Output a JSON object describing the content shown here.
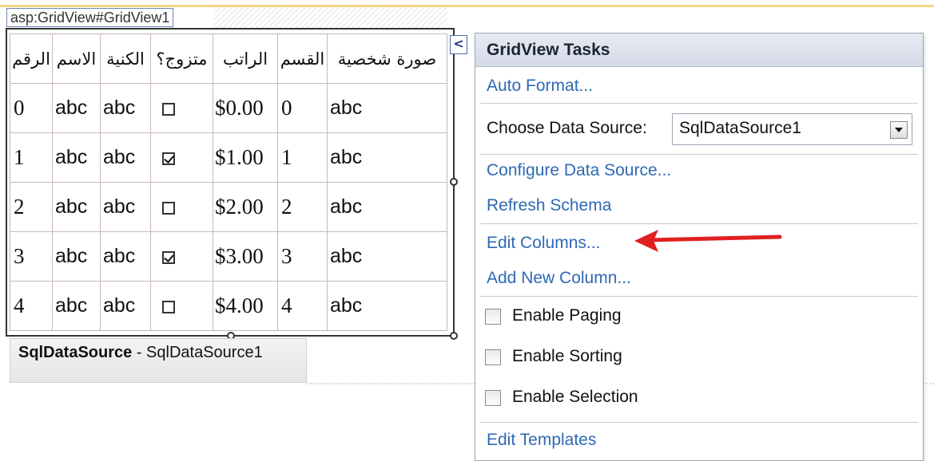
{
  "designer_tag": "asp:GridView#GridView1",
  "grid": {
    "headers": [
      "صورة شخصية",
      "القسم",
      "الراتب",
      "متزوج؟",
      "الكنية",
      "الاسم",
      "الرقم"
    ],
    "rows": [
      {
        "id": "0",
        "first": "abc",
        "last": "abc",
        "married": false,
        "salary": "$0.00",
        "dept": "0",
        "photo": "abc"
      },
      {
        "id": "1",
        "first": "abc",
        "last": "abc",
        "married": true,
        "salary": "$1.00",
        "dept": "1",
        "photo": "abc"
      },
      {
        "id": "2",
        "first": "abc",
        "last": "abc",
        "married": false,
        "salary": "$2.00",
        "dept": "2",
        "photo": "abc"
      },
      {
        "id": "3",
        "first": "abc",
        "last": "abc",
        "married": true,
        "salary": "$3.00",
        "dept": "3",
        "photo": "abc"
      },
      {
        "id": "4",
        "first": "abc",
        "last": "abc",
        "married": false,
        "salary": "$4.00",
        "dept": "4",
        "photo": "abc"
      }
    ]
  },
  "sql_data_source": {
    "type": "SqlDataSource",
    "separator": " - ",
    "name": "SqlDataSource1"
  },
  "collapse_button": "<",
  "tasks_panel": {
    "title": "GridView Tasks",
    "auto_format": "Auto Format...",
    "choose_data_source_label": "Choose Data Source:",
    "choose_data_source_value": "SqlDataSource1",
    "configure_data_source": "Configure Data Source...",
    "refresh_schema": "Refresh Schema",
    "edit_columns": "Edit Columns...",
    "add_new_column": "Add New Column...",
    "enable_paging": "Enable Paging",
    "enable_sorting": "Enable Sorting",
    "enable_selection": "Enable Selection",
    "edit_templates": "Edit Templates"
  },
  "colors": {
    "link": "#2e69b4",
    "arrow": "#e02020",
    "accent_line": "#f2d586"
  },
  "icons": [
    "collapse-arrow-icon",
    "dropdown-arrow-icon",
    "red-arrow-icon"
  ]
}
